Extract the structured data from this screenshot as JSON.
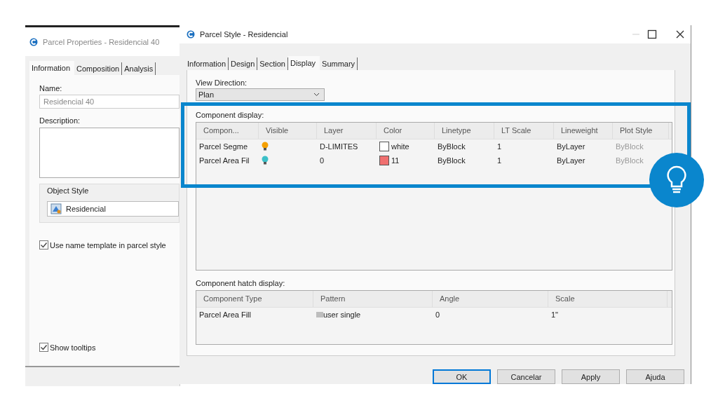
{
  "back_window": {
    "title": "Parcel Properties - Residencial 40",
    "tabs": [
      {
        "label": "Information",
        "selected": true
      },
      {
        "label": "Composition",
        "selected": false
      },
      {
        "label": "Analysis",
        "selected": false
      }
    ],
    "name_label": "Name:",
    "name_value": "Residencial 40",
    "description_label": "Description:",
    "object_style_label": "Object Style",
    "object_style_value": "Residencial",
    "checkboxes": [
      {
        "label": "Use name template in parcel style",
        "checked": true
      },
      {
        "label": "Show tooltips",
        "checked": true
      }
    ]
  },
  "window": {
    "title": "Parcel Style - Residencial",
    "tabs": [
      {
        "label": "Information",
        "selected": false
      },
      {
        "label": "Design",
        "selected": false
      },
      {
        "label": "Section",
        "selected": false
      },
      {
        "label": "Display",
        "selected": true
      },
      {
        "label": "Summary",
        "selected": false
      }
    ],
    "view_direction_label": "View Direction:",
    "view_direction_value": "Plan",
    "component_display": {
      "label": "Component display:",
      "columns": [
        "Compon...",
        "Visible",
        "Layer",
        "Color",
        "Linetype",
        "LT Scale",
        "Lineweight",
        "Plot Style"
      ],
      "rows": [
        {
          "component": "Parcel Segme",
          "visible": {
            "color": "#f5a000"
          },
          "layer": "D-LIMITES",
          "swatch": {
            "color": "#ffffff"
          },
          "color_value": "white",
          "linetype": "ByBlock",
          "lt_scale": "1",
          "lineweight": "ByLayer",
          "plot_style": "ByBlock",
          "plot_style_disabled": true
        },
        {
          "component": "Parcel Area Fil",
          "visible": {
            "color": "#3cc0c8"
          },
          "layer": "0",
          "swatch": {
            "color": "#f07070"
          },
          "color_value": "11",
          "linetype": "ByBlock",
          "lt_scale": "1",
          "lineweight": "ByLayer",
          "plot_style": "ByBlock",
          "plot_style_disabled": true
        }
      ]
    },
    "hatch_display": {
      "label": "Component hatch display:",
      "columns": [
        "Component Type",
        "Pattern",
        "Angle",
        "Scale"
      ],
      "rows": [
        [
          "Parcel Area Fill",
          "user single",
          "0",
          "1\""
        ]
      ]
    },
    "buttons": [
      {
        "label": "OK",
        "default": true
      },
      {
        "label": "Cancelar",
        "default": false
      },
      {
        "label": "Apply",
        "default": false
      },
      {
        "label": "Ajuda",
        "default": false
      }
    ]
  }
}
